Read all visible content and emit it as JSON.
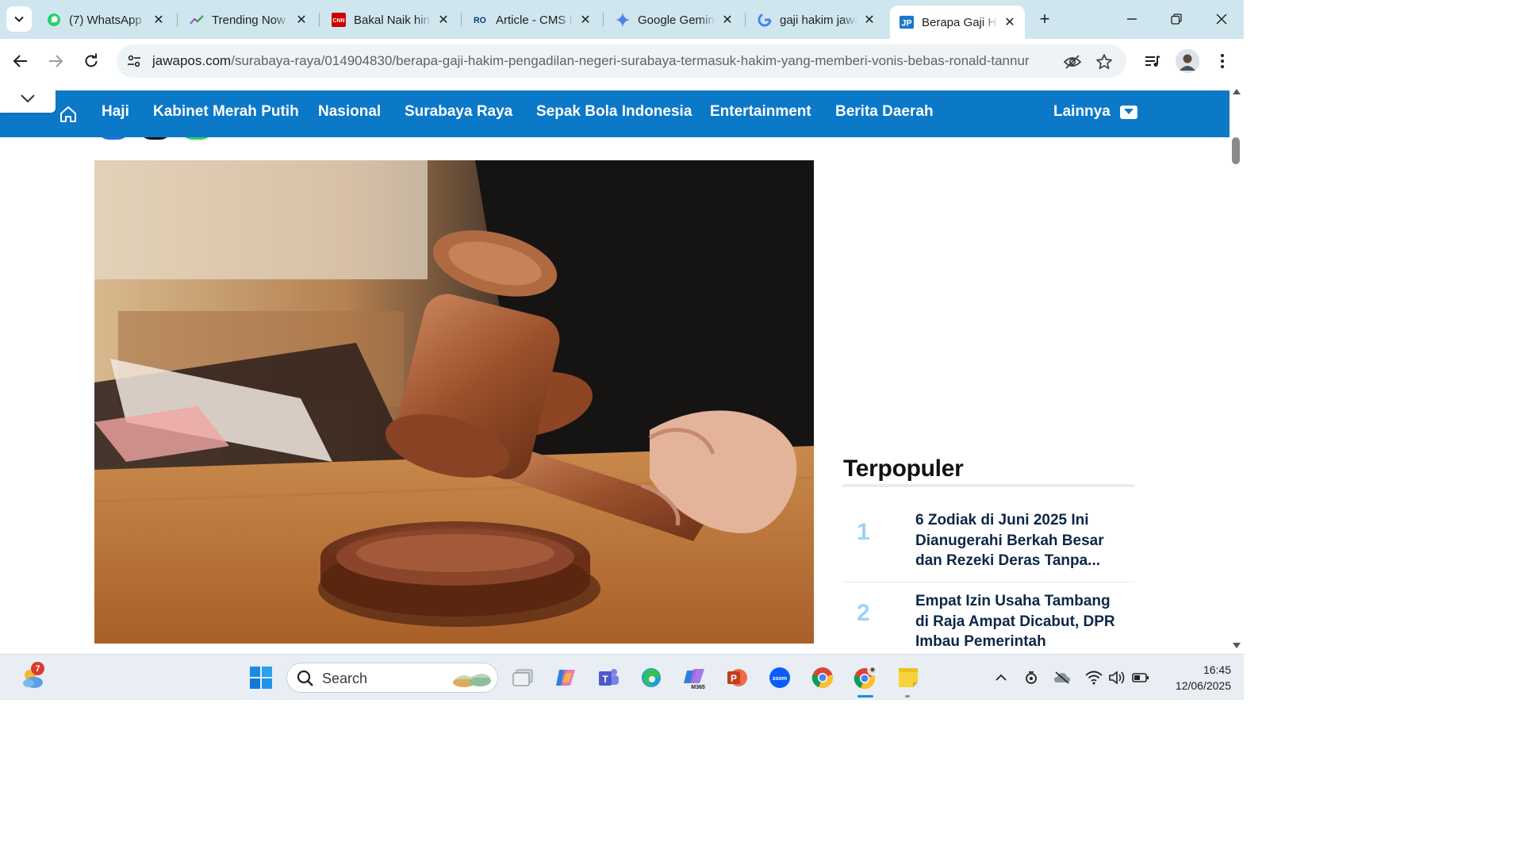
{
  "browser": {
    "tabs": [
      {
        "title": "(7) WhatsApp",
        "icon": "whatsapp-icon"
      },
      {
        "title": "Trending Now",
        "icon": "trending-icon"
      },
      {
        "title": "Bakal Naik hingga",
        "icon": "cnn-icon"
      },
      {
        "title": "Article - CMS Ind",
        "icon": "cms-icon"
      },
      {
        "title": "Google Gemini",
        "icon": "gemini-icon"
      },
      {
        "title": "gaji hakim jawapos",
        "icon": "google-icon"
      },
      {
        "title": "Berapa Gaji Hakim",
        "icon": "jawapos-icon",
        "active": true
      }
    ],
    "url_host": "jawapos.com",
    "url_path": "/surabaya-raya/014904830/berapa-gaji-hakim-pengadilan-negeri-surabaya-termasuk-hakim-yang-memberi-vonis-bebas-ronald-tannur"
  },
  "site": {
    "nav_items": [
      "Haji",
      "Kabinet Merah Putih",
      "Nasional",
      "Surabaya Raya",
      "Sepak Bola Indonesia",
      "Entertainment",
      "Berita Daerah"
    ],
    "nav_more": "Lainnya",
    "brand_color": "#0b78c8"
  },
  "sidebar": {
    "heading": "Terpopuler",
    "items": [
      {
        "rank": "1",
        "title": "6 Zodiak di Juni 2025 Ini Dianugerahi Berkah Besar dan Rezeki Deras Tanpa..."
      },
      {
        "rank": "2",
        "title": "Empat Izin Usaha Tambang di Raja Ampat Dicabut, DPR Imbau Pemerintah Konsiste..."
      }
    ]
  },
  "taskbar": {
    "weather_badge": "7",
    "search_placeholder": "Search",
    "time": "16:45",
    "date": "12/06/2025"
  }
}
